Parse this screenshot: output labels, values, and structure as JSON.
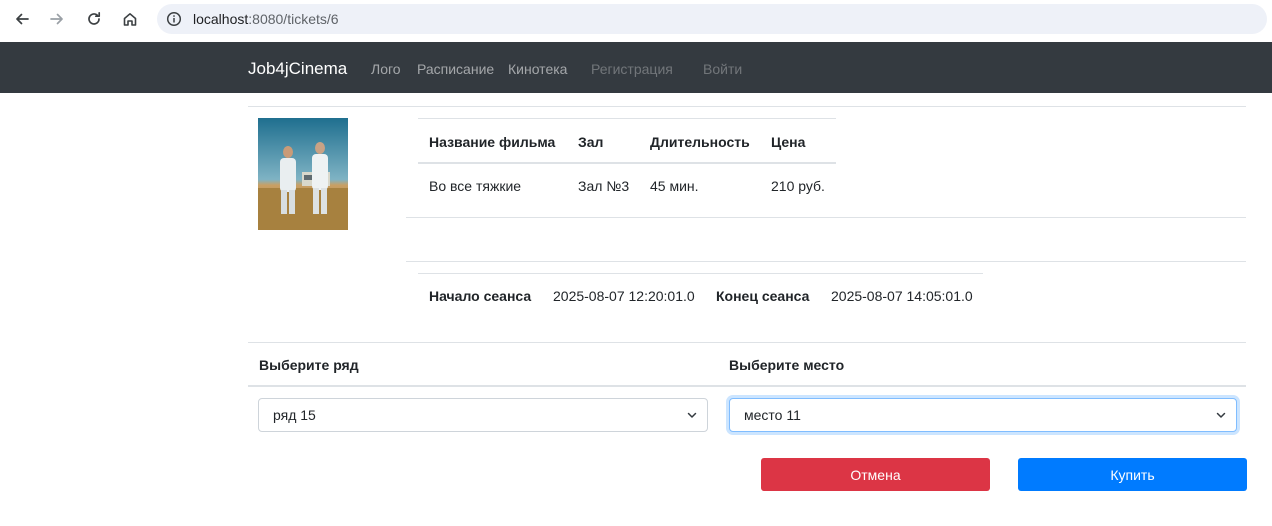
{
  "browser": {
    "url_host": "localhost",
    "url_path": ":8080/tickets/6",
    "icons": [
      "back-icon",
      "forward-icon",
      "reload-icon",
      "home-icon",
      "info-icon"
    ]
  },
  "navbar": {
    "brand": "Job4jCinema",
    "links": [
      "Лого",
      "Расписание",
      "Кинотека",
      "Регистрация",
      "Войти"
    ]
  },
  "film_table": {
    "headers": [
      "Название фильма",
      "Зал",
      "Длительность",
      "Цена"
    ],
    "row": [
      "Во все тяжкие",
      "Зал №3",
      "45 мин.",
      "210 руб."
    ]
  },
  "session": {
    "start_label": "Начало сеанса",
    "start_value": "2025-08-07 12:20:01.0",
    "end_label": "Конец сеанса",
    "end_value": "2025-08-07 14:05:01.0"
  },
  "selection": {
    "row_label": "Выберите ряд",
    "row_value": "ряд 15",
    "place_label": "Выберите место",
    "place_value": "место 11"
  },
  "actions": {
    "cancel": "Отмена",
    "buy": "Купить"
  },
  "colors": {
    "navbar": "#343a40",
    "danger": "#dc3545",
    "primary": "#007bff"
  }
}
